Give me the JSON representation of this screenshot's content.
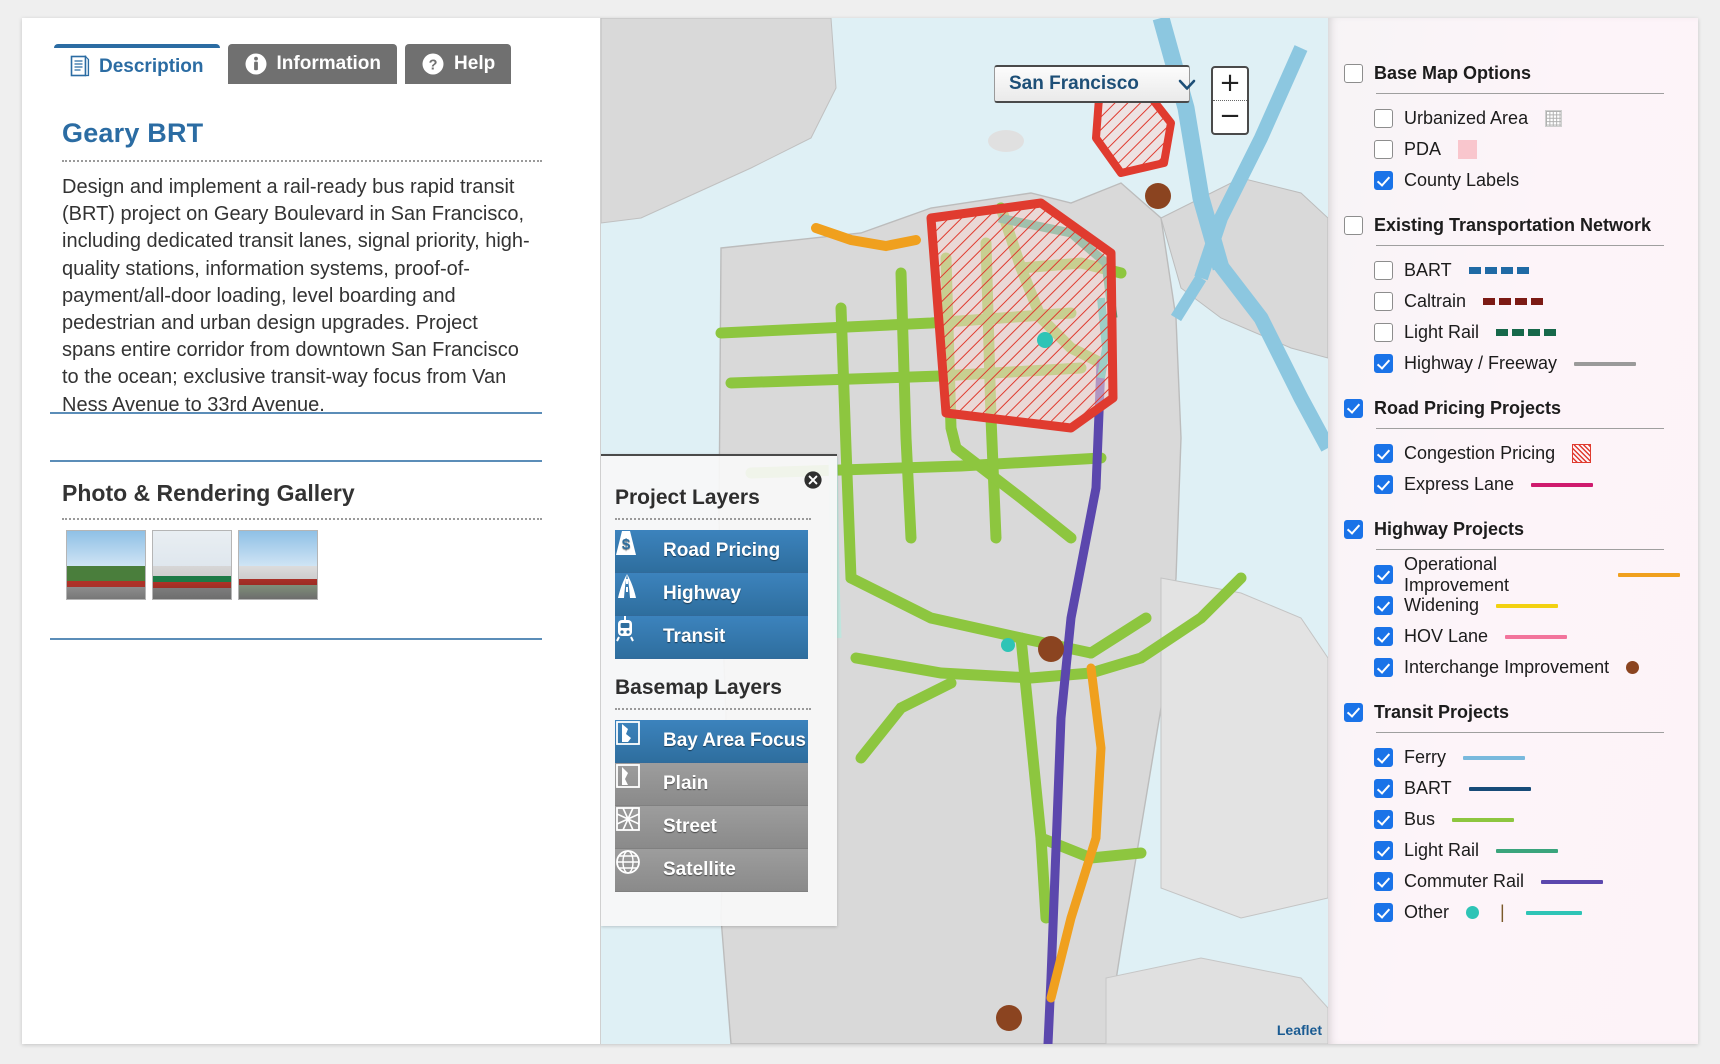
{
  "tabs": [
    {
      "label": "Description",
      "icon": "document-icon",
      "active": true
    },
    {
      "label": "Information",
      "icon": "info-icon",
      "active": false
    },
    {
      "label": "Help",
      "icon": "question-icon",
      "active": false
    }
  ],
  "project": {
    "title": "Geary BRT",
    "description": "Design and implement a rail-ready bus rapid transit (BRT) project on Geary Boulevard in San Francisco, including dedicated transit lanes, signal priority, high-quality stations, information systems, proof-of-payment/all-door loading, level boarding and pedestrian and urban design upgrades. Project spans entire corridor from downtown San Francisco to the ocean; exclusive transit-way focus from Van Ness Avenue to 33rd Avenue.",
    "gallery_title": "Photo & Rendering Gallery",
    "gallery_count": 3
  },
  "map": {
    "city_selected": "San Francisco",
    "zoom_in_label": "+",
    "zoom_out_label": "−",
    "attribution": "Leaflet",
    "layers_panel": {
      "project_layers_title": "Project Layers",
      "project_layers": [
        {
          "label": "Road Pricing",
          "icon": "dollar-sign-road-icon",
          "state": "active"
        },
        {
          "label": "Highway",
          "icon": "highway-icon",
          "state": "active"
        },
        {
          "label": "Transit",
          "icon": "train-icon",
          "state": "active"
        }
      ],
      "basemap_layers_title": "Basemap Layers",
      "basemap_layers": [
        {
          "label": "Bay Area Focus",
          "icon": "bay-area-map-icon",
          "state": "active"
        },
        {
          "label": "Plain",
          "icon": "plain-map-icon",
          "state": "inactive"
        },
        {
          "label": "Street",
          "icon": "street-grid-icon",
          "state": "inactive"
        },
        {
          "label": "Satellite",
          "icon": "globe-icon",
          "state": "inactive"
        }
      ]
    }
  },
  "legend": {
    "groups": [
      {
        "title": "Base Map Options",
        "checked": false,
        "items": [
          {
            "label": "Urbanized Area",
            "checked": false,
            "swatch": {
              "type": "grid",
              "color": "#b0b0b0"
            }
          },
          {
            "label": "PDA",
            "checked": false,
            "swatch": {
              "type": "square",
              "color": "#f9c6cd"
            }
          },
          {
            "label": "County Labels",
            "checked": true,
            "swatch": {
              "type": "none"
            }
          }
        ]
      },
      {
        "title": "Existing Transportation Network",
        "checked": false,
        "items": [
          {
            "label": "BART",
            "checked": false,
            "swatch": {
              "type": "dashed",
              "color": "#1f6aa5"
            }
          },
          {
            "label": "Caltrain",
            "checked": false,
            "swatch": {
              "type": "dashed",
              "color": "#7c1a14"
            }
          },
          {
            "label": "Light Rail",
            "checked": false,
            "swatch": {
              "type": "dashed",
              "color": "#16684a"
            }
          },
          {
            "label": "Highway / Freeway",
            "checked": true,
            "swatch": {
              "type": "line",
              "color": "#9a9a9a"
            }
          }
        ]
      },
      {
        "title": "Road Pricing Projects",
        "checked": true,
        "items": [
          {
            "label": "Congestion Pricing",
            "checked": true,
            "swatch": {
              "type": "hatch",
              "color": "#e03b2f"
            }
          },
          {
            "label": "Express Lane",
            "checked": true,
            "swatch": {
              "type": "line",
              "color": "#cf1a6e"
            }
          }
        ]
      },
      {
        "title": "Highway Projects",
        "checked": true,
        "items": [
          {
            "label": "Operational Improvement",
            "checked": true,
            "swatch": {
              "type": "line",
              "color": "#f0a01e"
            }
          },
          {
            "label": "Widening",
            "checked": true,
            "swatch": {
              "type": "line",
              "color": "#f2d111"
            }
          },
          {
            "label": "HOV Lane",
            "checked": true,
            "swatch": {
              "type": "line",
              "color": "#f2749c"
            }
          },
          {
            "label": "Interchange Improvement",
            "checked": true,
            "swatch": {
              "type": "dot",
              "color": "#8b4420"
            }
          }
        ]
      },
      {
        "title": "Transit Projects",
        "checked": true,
        "items": [
          {
            "label": "Ferry",
            "checked": true,
            "swatch": {
              "type": "line",
              "color": "#79b9dd"
            }
          },
          {
            "label": "BART",
            "checked": true,
            "swatch": {
              "type": "line",
              "color": "#174b78"
            }
          },
          {
            "label": "Bus",
            "checked": true,
            "swatch": {
              "type": "line",
              "color": "#8dc63f"
            }
          },
          {
            "label": "Light Rail",
            "checked": true,
            "swatch": {
              "type": "line",
              "color": "#3aa47c"
            }
          },
          {
            "label": "Commuter Rail",
            "checked": true,
            "swatch": {
              "type": "line",
              "color": "#5b47ad"
            }
          },
          {
            "label": "Other",
            "checked": true,
            "swatch": {
              "type": "dot-bar-line",
              "color": "#2ec4b6"
            },
            "separator": "|"
          }
        ]
      }
    ]
  }
}
